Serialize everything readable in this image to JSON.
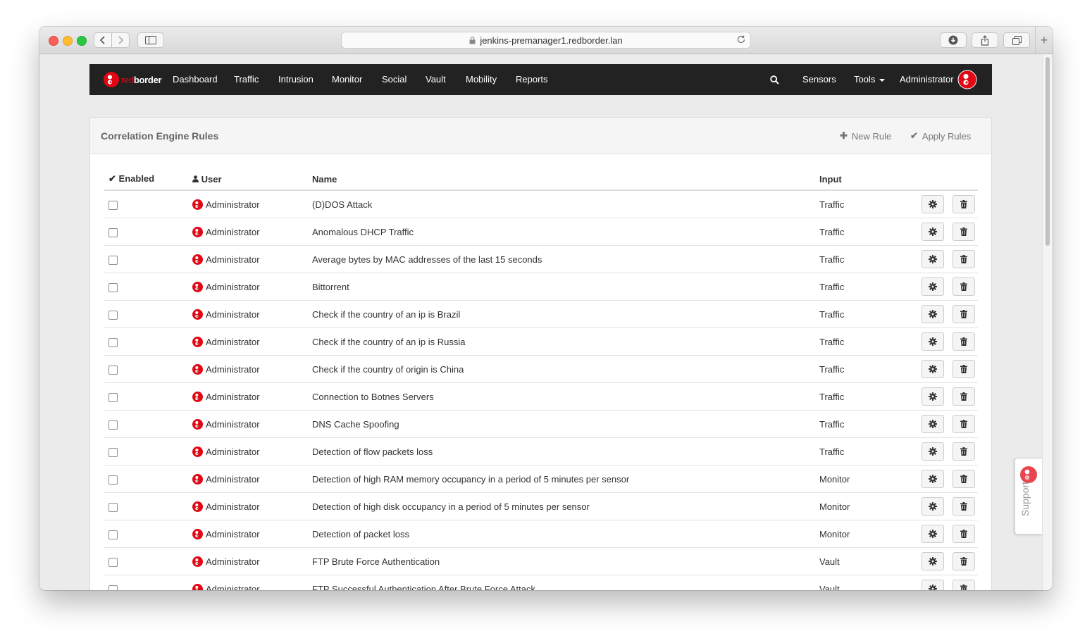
{
  "browser": {
    "url": "jenkins-premanager1.redborder.lan"
  },
  "navbar": {
    "brand_red": "red",
    "brand_white": "border",
    "items": [
      "Dashboard",
      "Traffic",
      "Intrusion",
      "Monitor",
      "Social",
      "Vault",
      "Mobility",
      "Reports"
    ],
    "sensors_label": "Sensors",
    "tools_label": "Tools",
    "user_label": "Administrator"
  },
  "panel": {
    "title": "Correlation Engine Rules",
    "new_rule_label": "New Rule",
    "apply_rules_label": "Apply Rules"
  },
  "table": {
    "headers": {
      "enabled": "Enabled",
      "user": "User",
      "name": "Name",
      "input": "Input"
    },
    "rows": [
      {
        "user": "Administrator",
        "name": "(D)DOS Attack",
        "input": "Traffic"
      },
      {
        "user": "Administrator",
        "name": "Anomalous DHCP Traffic",
        "input": "Traffic"
      },
      {
        "user": "Administrator",
        "name": "Average bytes by MAC addresses of the last 15 seconds",
        "input": "Traffic"
      },
      {
        "user": "Administrator",
        "name": "Bittorrent",
        "input": "Traffic"
      },
      {
        "user": "Administrator",
        "name": "Check if the country of an ip is Brazil",
        "input": "Traffic"
      },
      {
        "user": "Administrator",
        "name": "Check if the country of an ip is Russia",
        "input": "Traffic"
      },
      {
        "user": "Administrator",
        "name": "Check if the country of origin is China",
        "input": "Traffic"
      },
      {
        "user": "Administrator",
        "name": "Connection to Botnes Servers",
        "input": "Traffic"
      },
      {
        "user": "Administrator",
        "name": "DNS Cache Spoofing",
        "input": "Traffic"
      },
      {
        "user": "Administrator",
        "name": "Detection of flow packets loss",
        "input": "Traffic"
      },
      {
        "user": "Administrator",
        "name": "Detection of high RAM memory occupancy in a period of 5 minutes per sensor",
        "input": "Monitor"
      },
      {
        "user": "Administrator",
        "name": "Detection of high disk occupancy in a period of 5 minutes per sensor",
        "input": "Monitor"
      },
      {
        "user": "Administrator",
        "name": "Detection of packet loss",
        "input": "Monitor"
      },
      {
        "user": "Administrator",
        "name": "FTP Brute Force Authentication",
        "input": "Vault"
      },
      {
        "user": "Administrator",
        "name": "FTP Successful Authentication After Brute Force Attack",
        "input": "Vault"
      }
    ]
  },
  "support": {
    "label": "Support"
  },
  "colors": {
    "brand": "#e30613",
    "navbar": "#222222"
  }
}
